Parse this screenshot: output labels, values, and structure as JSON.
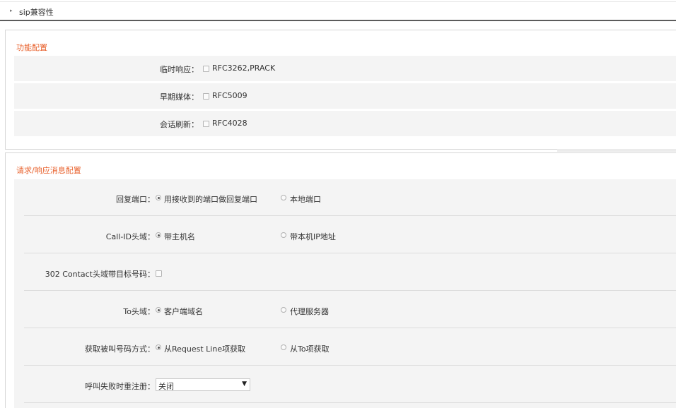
{
  "header": {
    "title": "sip兼容性",
    "arrow": "▸"
  },
  "feature_config": {
    "title": "功能配置",
    "rows": [
      {
        "label": "临时响应",
        "colon": "：",
        "option": "RFC3262,PRACK",
        "checked": false
      },
      {
        "label": "早期媒体",
        "colon": "：",
        "option": "RFC5009",
        "checked": false
      },
      {
        "label": "会话刷新",
        "colon": "：",
        "option": "RFC4028",
        "checked": false
      }
    ]
  },
  "request_config": {
    "title": "请求/响应消息配置",
    "reply_port": {
      "label": "回复端口",
      "colon": "：",
      "opt1": "用接收到的端口做回复端口",
      "opt2": "本地端口",
      "selected": 1
    },
    "callid": {
      "label": "Call-ID头域",
      "colon": "：",
      "opt1": "带主机名",
      "opt2": "带本机IP地址",
      "selected": 1
    },
    "contact302": {
      "label": "302 Contact头域带目标号码",
      "colon": "：",
      "checked": false
    },
    "to_header": {
      "label": "To头域",
      "colon": "：",
      "opt1": "客户端域名",
      "opt2": "代理服务器",
      "selected": 1
    },
    "called_number": {
      "label": "获取被叫号码方式",
      "colon": "：",
      "opt1": "从Request Line项获取",
      "opt2": "从To项获取",
      "selected": 1
    },
    "reregister": {
      "label": "呼叫失败时重注册",
      "colon": "：",
      "value": "关闭",
      "arrow": "▼"
    }
  },
  "colors": {
    "accent": "#e8612c",
    "row_bg": "#f4f4f4",
    "divider": "#dcdcdc"
  }
}
